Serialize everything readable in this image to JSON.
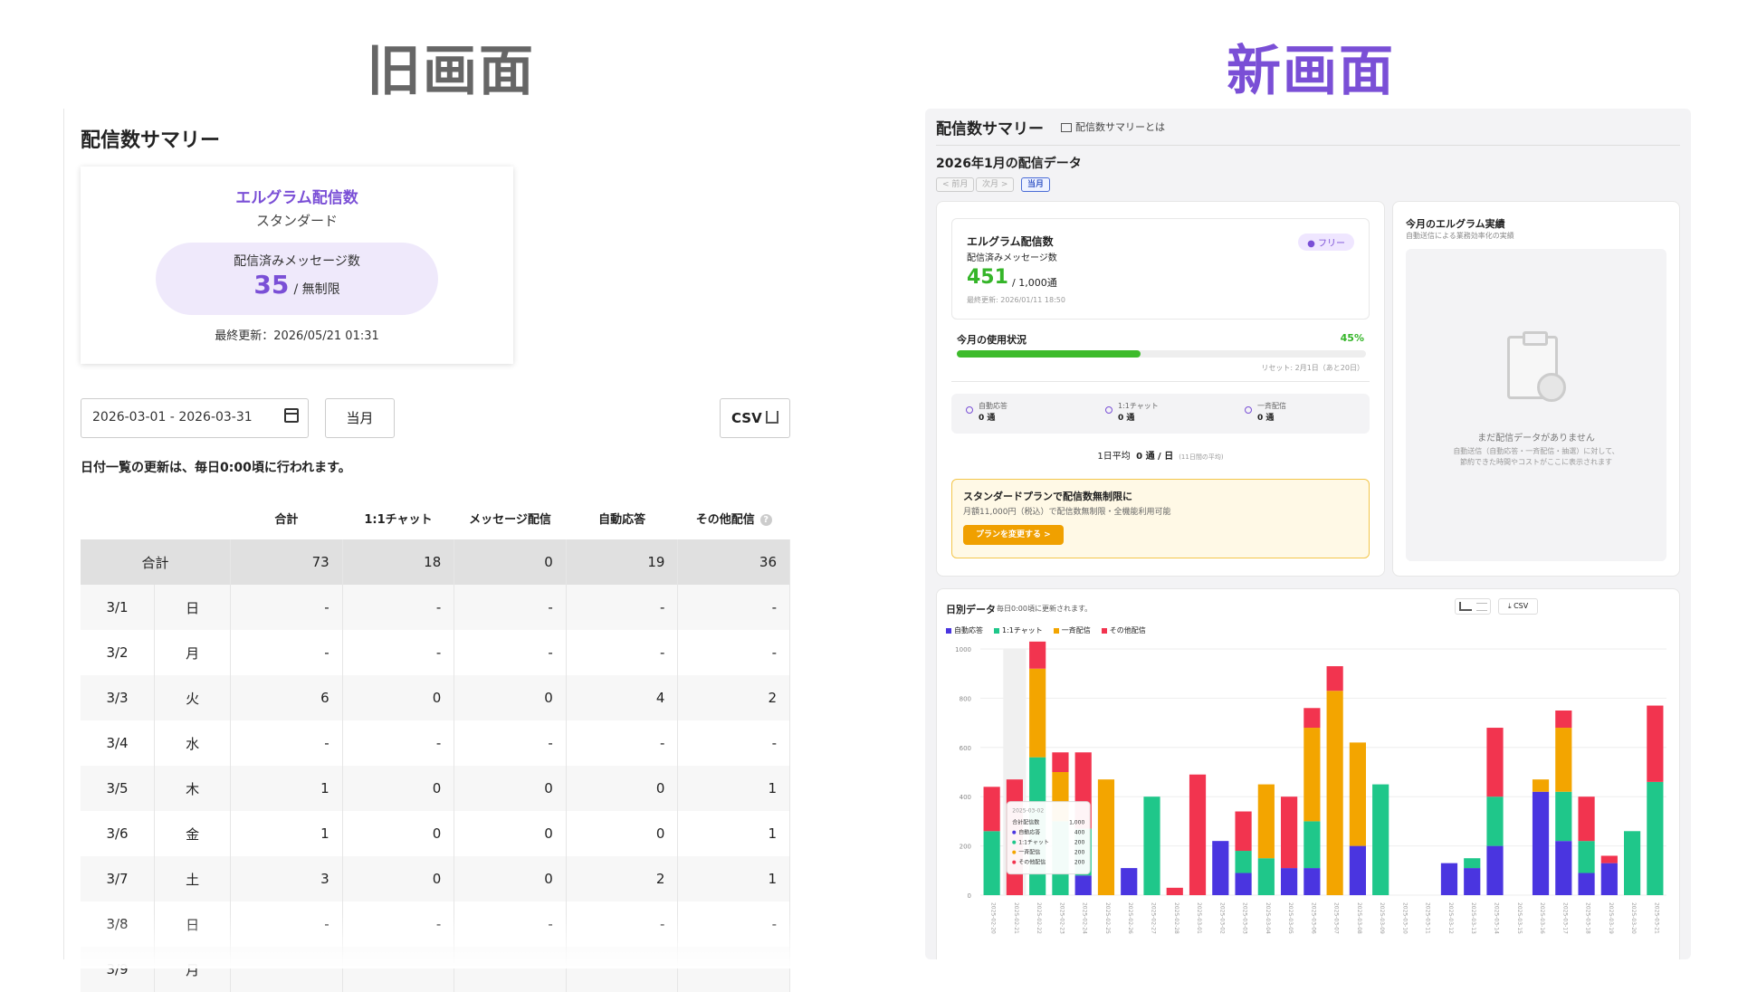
{
  "headings": {
    "old": "旧画面",
    "new": "新画面"
  },
  "old": {
    "title": "配信数サマリー",
    "card": {
      "title": "エルグラム配信数",
      "plan": "スタンダード",
      "count_label": "配信済みメッセージ数",
      "count": "35",
      "count_unit": "/ 無制限",
      "updated": "最終更新：2026/05/21 01:31"
    },
    "date_range": "2026-03-01 - 2026-03-31",
    "month_button": "当月",
    "csv_button": "CSV",
    "note": "日付一覧の更新は、毎日0:00頃に行われます。",
    "columns": [
      "合計",
      "1:1チャット",
      "メッセージ配信",
      "自動応答",
      "その他配信"
    ],
    "total_row": {
      "label": "合計",
      "values": [
        "73",
        "18",
        "0",
        "19",
        "36"
      ]
    },
    "rows": [
      {
        "date": "3/1",
        "day": "日",
        "values": [
          "-",
          "-",
          "-",
          "-",
          "-"
        ]
      },
      {
        "date": "3/2",
        "day": "月",
        "values": [
          "-",
          "-",
          "-",
          "-",
          "-"
        ]
      },
      {
        "date": "3/3",
        "day": "火",
        "values": [
          "6",
          "0",
          "0",
          "4",
          "2"
        ]
      },
      {
        "date": "3/4",
        "day": "水",
        "values": [
          "-",
          "-",
          "-",
          "-",
          "-"
        ]
      },
      {
        "date": "3/5",
        "day": "木",
        "values": [
          "1",
          "0",
          "0",
          "0",
          "1"
        ]
      },
      {
        "date": "3/6",
        "day": "金",
        "values": [
          "1",
          "0",
          "0",
          "0",
          "1"
        ]
      },
      {
        "date": "3/7",
        "day": "土",
        "values": [
          "3",
          "0",
          "0",
          "2",
          "1"
        ]
      },
      {
        "date": "3/8",
        "day": "日",
        "values": [
          "-",
          "-",
          "-",
          "-",
          "-"
        ]
      },
      {
        "date": "3/9",
        "day": "月",
        "values": [
          "",
          "",
          "",
          "",
          ""
        ]
      }
    ]
  },
  "new": {
    "title": "配信数サマリー",
    "about_link": "配信数サマリーとは",
    "period": "2026年1月の配信データ",
    "nav": {
      "prev": "< 前月",
      "next": "次月 >",
      "current": "当月"
    },
    "usage": {
      "title": "エルグラム配信数",
      "badge": "● フリー",
      "sub": "配信済みメッセージ数",
      "count": "451",
      "limit": "/ 1,000通",
      "updated": "最終更新: 2026/01/11 18:50",
      "month_label": "今月の使用状況",
      "percent_text": "45%",
      "percent": 0.45,
      "reset": "リセット: 2月1日（あと20日）",
      "breakdown": [
        {
          "label": "自動応答",
          "value": "0 通"
        },
        {
          "label": "1:1チャット",
          "value": "0 通"
        },
        {
          "label": "一斉配信",
          "value": "0 通"
        }
      ],
      "daily_avg_label": "1日平均",
      "daily_avg_value": "0 通 / 日",
      "daily_avg_note": "(11日間の平均)"
    },
    "upsell": {
      "title": "スタンダードプランで配信数無制限に",
      "desc": "月額11,000円（税込）で配信数無制限・全機能利用可能",
      "button": "プランを変更する >"
    },
    "results": {
      "title": "今月のエルグラム実績",
      "sub": "自動送信による業務効率化の実績",
      "empty_title": "まだ配信データがありません",
      "empty_desc1": "自動送信（自動応答・一斉配信・抽選）に対して、",
      "empty_desc2": "節約できた時間やコストがここに表示されます"
    },
    "daily": {
      "title": "日別データ",
      "note": "毎日0:00頃に更新されます。",
      "csv": "CSV"
    }
  },
  "chart_data": {
    "type": "bar",
    "stacked": true,
    "ylim": [
      0,
      1000
    ],
    "yticks": [
      0,
      200,
      400,
      600,
      800,
      1000
    ],
    "categories": [
      "2025-02-20",
      "2025-02-21",
      "2025-02-22",
      "2025-02-23",
      "2025-02-24",
      "2025-02-25",
      "2025-02-26",
      "2025-02-27",
      "2025-02-28",
      "2025-03-01",
      "2025-03-02",
      "2025-03-03",
      "2025-03-04",
      "2025-03-05",
      "2025-03-06",
      "2025-03-07",
      "2025-03-08",
      "2025-03-09",
      "2025-03-10",
      "2025-03-11",
      "2025-03-12",
      "2025-03-13",
      "2025-03-14",
      "2025-03-15",
      "2025-03-16",
      "2025-03-17",
      "2025-03-18",
      "2025-03-19",
      "2025-03-20",
      "2025-03-21"
    ],
    "series": [
      {
        "name": "自動応答",
        "color": "#4a35e0",
        "values": [
          0,
          0,
          0,
          0,
          80,
          0,
          110,
          0,
          0,
          0,
          220,
          90,
          0,
          110,
          110,
          0,
          200,
          0,
          0,
          0,
          130,
          110,
          200,
          0,
          420,
          220,
          90,
          130,
          0,
          0
        ]
      },
      {
        "name": "1:1チャット",
        "color": "#1fc78a",
        "values": [
          260,
          0,
          560,
          300,
          190,
          0,
          0,
          400,
          0,
          0,
          0,
          90,
          150,
          0,
          190,
          0,
          0,
          450,
          0,
          0,
          0,
          40,
          200,
          0,
          0,
          200,
          130,
          0,
          260,
          460
        ]
      },
      {
        "name": "一斉配信",
        "color": "#f3a500",
        "values": [
          0,
          0,
          360,
          200,
          0,
          470,
          0,
          0,
          0,
          0,
          0,
          0,
          300,
          0,
          380,
          830,
          420,
          0,
          0,
          0,
          0,
          0,
          0,
          0,
          50,
          260,
          0,
          0,
          0,
          0
        ]
      },
      {
        "name": "その他配信",
        "color": "#f2344f",
        "values": [
          180,
          470,
          110,
          80,
          310,
          0,
          0,
          0,
          30,
          490,
          0,
          160,
          0,
          290,
          80,
          100,
          0,
          0,
          0,
          0,
          0,
          0,
          280,
          0,
          0,
          70,
          180,
          30,
          0,
          310
        ]
      }
    ],
    "tooltip": {
      "date": "2025-03-02",
      "rows": [
        {
          "label": "合計配信数",
          "value": "1,000"
        },
        {
          "label": "自動応答",
          "value": "400"
        },
        {
          "label": "1:1チャット",
          "value": "200"
        },
        {
          "label": "一斉配信",
          "value": "200"
        },
        {
          "label": "その他配信",
          "value": "200"
        }
      ]
    }
  }
}
